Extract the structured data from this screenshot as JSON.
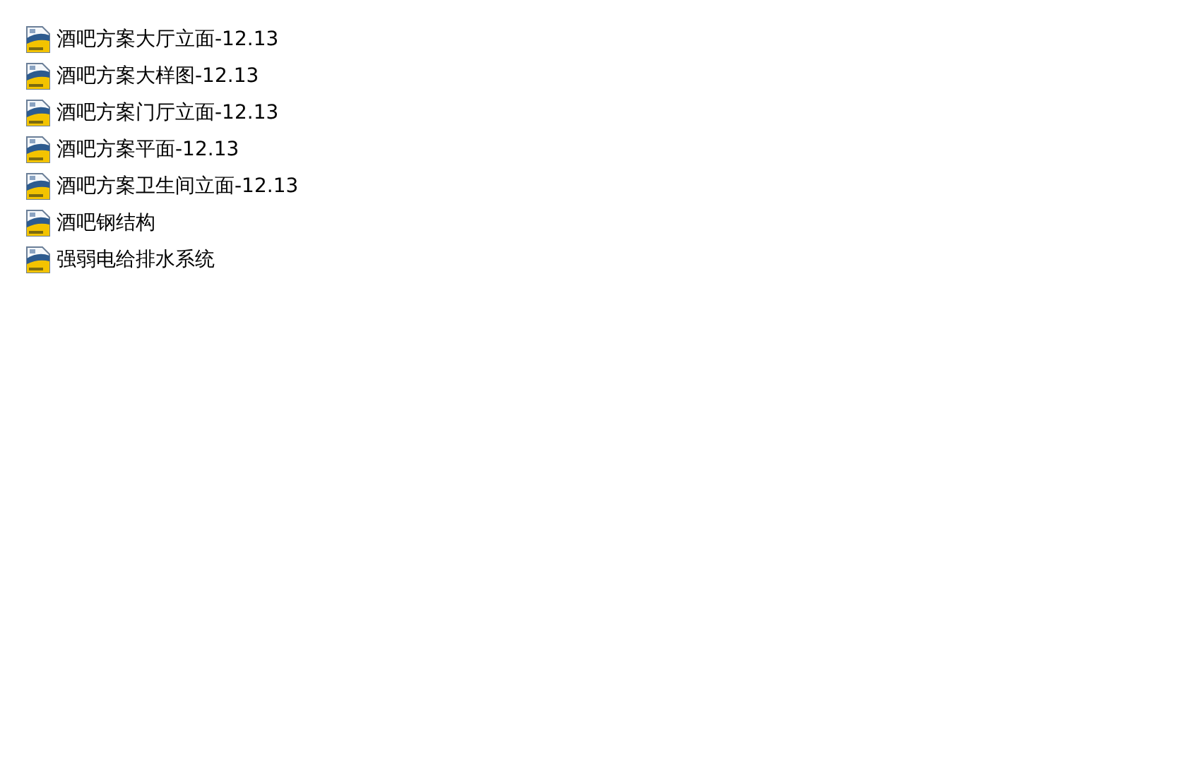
{
  "files": [
    {
      "name": "酒吧方案大厅立面-12.13"
    },
    {
      "name": "酒吧方案大样图-12.13"
    },
    {
      "name": "酒吧方案门厅立面-12.13"
    },
    {
      "name": "酒吧方案平面-12.13"
    },
    {
      "name": "酒吧方案卫生间立面-12.13"
    },
    {
      "name": "酒吧钢结构"
    },
    {
      "name": "强弱电给排水系统"
    }
  ]
}
